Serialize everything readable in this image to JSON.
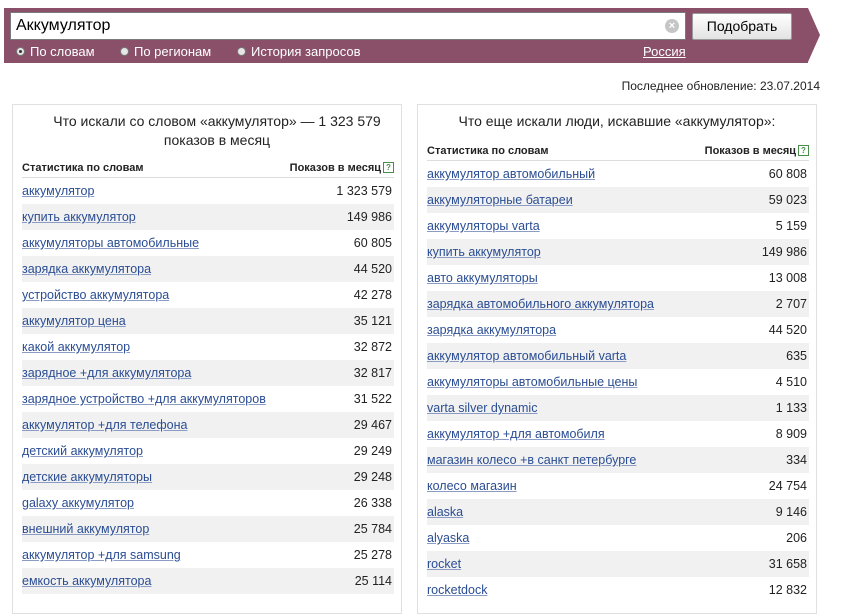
{
  "search": {
    "value": "Аккумулятор",
    "button_label": "Подобрать"
  },
  "tabs": [
    {
      "label": "По словам",
      "selected": true
    },
    {
      "label": "По регионам",
      "selected": false
    },
    {
      "label": "История запросов",
      "selected": false
    }
  ],
  "region": "Россия",
  "last_update": "Последнее обновление: 23.07.2014",
  "colors": {
    "header_bg": "#8a5069",
    "link": "#2a4d93",
    "row_alt": "#f1f1f1"
  },
  "left_panel": {
    "title": "Что искали со словом «аккумулятор» — 1 323 579 показов в месяц",
    "col_phrase": "Статистика по словам",
    "col_shows": "Показов в месяц",
    "rows": [
      {
        "phrase": "аккумулятор",
        "shows": "1 323 579"
      },
      {
        "phrase": "купить аккумулятор",
        "shows": "149 986"
      },
      {
        "phrase": "аккумуляторы автомобильные",
        "shows": "60 805"
      },
      {
        "phrase": "зарядка аккумулятора",
        "shows": "44 520"
      },
      {
        "phrase": "устройство аккумулятора",
        "shows": "42 278"
      },
      {
        "phrase": "аккумулятор цена",
        "shows": "35 121"
      },
      {
        "phrase": "какой аккумулятор",
        "shows": "32 872"
      },
      {
        "phrase": "зарядное +для аккумулятора",
        "shows": "32 817"
      },
      {
        "phrase": "зарядное устройство +для аккумуляторов",
        "shows": "31 522"
      },
      {
        "phrase": "аккумулятор +для телефона",
        "shows": "29 467"
      },
      {
        "phrase": "детский аккумулятор",
        "shows": "29 249"
      },
      {
        "phrase": "детские аккумуляторы",
        "shows": "29 248"
      },
      {
        "phrase": "galaxy аккумулятор",
        "shows": "26 338"
      },
      {
        "phrase": "внешний аккумулятор",
        "shows": "25 784"
      },
      {
        "phrase": "аккумулятор +для samsung",
        "shows": "25 278"
      },
      {
        "phrase": "емкость аккумулятора",
        "shows": "25 114"
      }
    ]
  },
  "right_panel": {
    "title": "Что еще искали люди, искавшие «аккумулятор»:",
    "col_phrase": "Статистика по словам",
    "col_shows": "Показов в месяц",
    "rows": [
      {
        "phrase": "аккумулятор автомобильный",
        "shows": "60 808"
      },
      {
        "phrase": "аккумуляторные батареи",
        "shows": "59 023"
      },
      {
        "phrase": "аккумуляторы varta",
        "shows": "5 159"
      },
      {
        "phrase": "купить аккумулятор",
        "shows": "149 986"
      },
      {
        "phrase": "авто аккумуляторы",
        "shows": "13 008"
      },
      {
        "phrase": "зарядка автомобильного аккумулятора",
        "shows": "2 707"
      },
      {
        "phrase": "зарядка аккумулятора",
        "shows": "44 520"
      },
      {
        "phrase": "аккумулятор автомобильный varta",
        "shows": "635"
      },
      {
        "phrase": "аккумуляторы автомобильные цены",
        "shows": "4 510"
      },
      {
        "phrase": "varta silver dynamic",
        "shows": "1 133"
      },
      {
        "phrase": "аккумулятор +для автомобиля",
        "shows": "8 909"
      },
      {
        "phrase": "магазин колесо +в санкт петербурге",
        "shows": "334"
      },
      {
        "phrase": "колесо магазин",
        "shows": "24 754"
      },
      {
        "phrase": "alaska",
        "shows": "9 146"
      },
      {
        "phrase": "alyaska",
        "shows": "206"
      },
      {
        "phrase": "rocket",
        "shows": "31 658"
      },
      {
        "phrase": "rocketdock",
        "shows": "12 832"
      }
    ]
  }
}
